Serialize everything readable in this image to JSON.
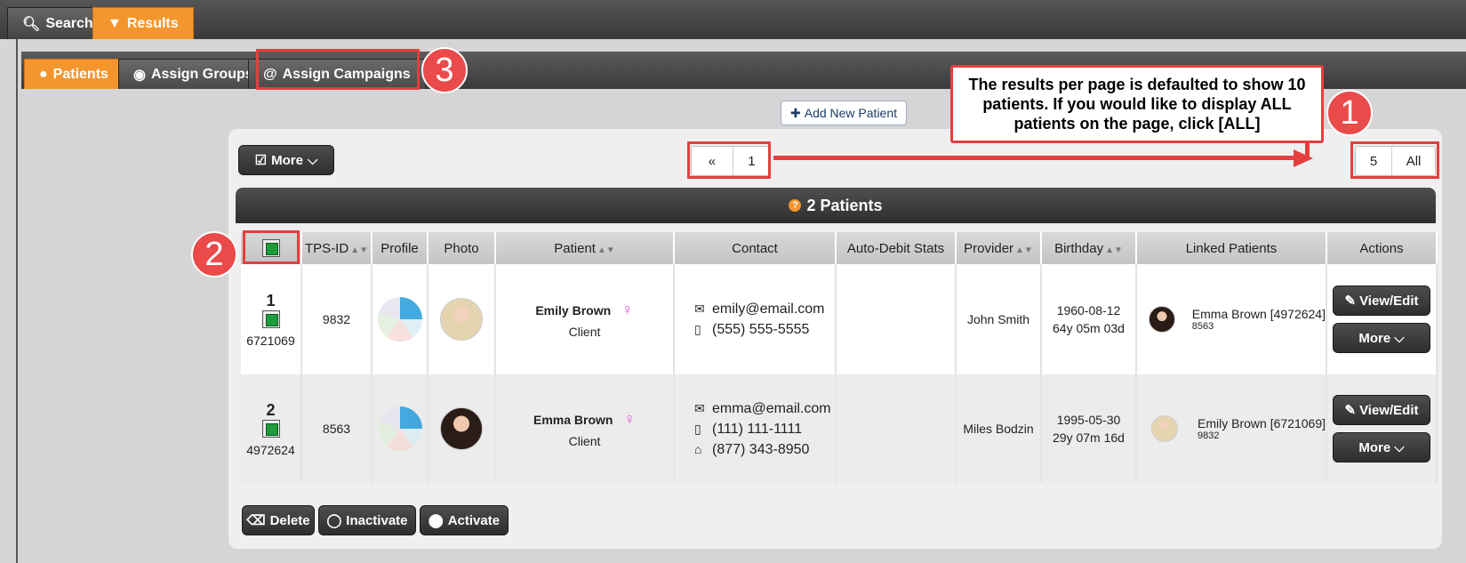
{
  "top_tabs": [
    {
      "label": "Search",
      "icon": "search-icon"
    },
    {
      "label": "Results",
      "icon": "filter-icon",
      "active": true
    }
  ],
  "sub_tabs": [
    {
      "label": "Patients",
      "icon": "user-icon",
      "active": true
    },
    {
      "label": "Assign Groups",
      "icon": "groups-icon"
    },
    {
      "label": "Assign Campaigns",
      "icon": "at-icon"
    }
  ],
  "annotations": {
    "num1": "1",
    "num2": "2",
    "num3": "3",
    "callout_text": "The results per page is defaulted to show 10 patients. If you would like to display ALL patients on the page, click [ALL]"
  },
  "add_patient_label": "Add New Patient",
  "more_label": "More",
  "pager": {
    "first": "«",
    "page": "1"
  },
  "per_page": {
    "five": "5",
    "all": "All"
  },
  "patients_count_label": "2 Patients",
  "columns": [
    "TPS-ID",
    "Profile",
    "Photo",
    "Patient",
    "Contact",
    "Auto-Debit Stats",
    "Provider",
    "Birthday",
    "Linked Patients",
    "Actions"
  ],
  "rows": [
    {
      "num": "1",
      "patient_id": "6721069",
      "tps_id": "9832",
      "name": "Emily Brown",
      "type": "Client",
      "email": "emily@email.com",
      "phone": "(555) 555-5555",
      "home": "",
      "provider": "John Smith",
      "birth_date": "1960-08-12",
      "age": "64y 05m 03d",
      "linked_name": "Emma Brown [4972624]",
      "linked_tps": "8563",
      "view_label": "View/Edit",
      "more_label": "More"
    },
    {
      "num": "2",
      "patient_id": "4972624",
      "tps_id": "8563",
      "name": "Emma Brown",
      "type": "Client",
      "email": "emma@email.com",
      "phone": "(111) 111-1111",
      "home": "(877) 343-8950",
      "provider": "Miles Bodzin",
      "birth_date": "1995-05-30",
      "age": "29y 07m 16d",
      "linked_name": "Emily Brown [6721069]",
      "linked_tps": "9832",
      "view_label": "View/Edit",
      "more_label": "More"
    }
  ],
  "bottom_buttons": {
    "delete": "Delete",
    "inactivate": "Inactivate",
    "activate": "Activate"
  },
  "colors": {
    "accent": "#f4962e",
    "annotation": "#e63e3e",
    "check": "#1e9b3b",
    "female": "#e256d8"
  }
}
